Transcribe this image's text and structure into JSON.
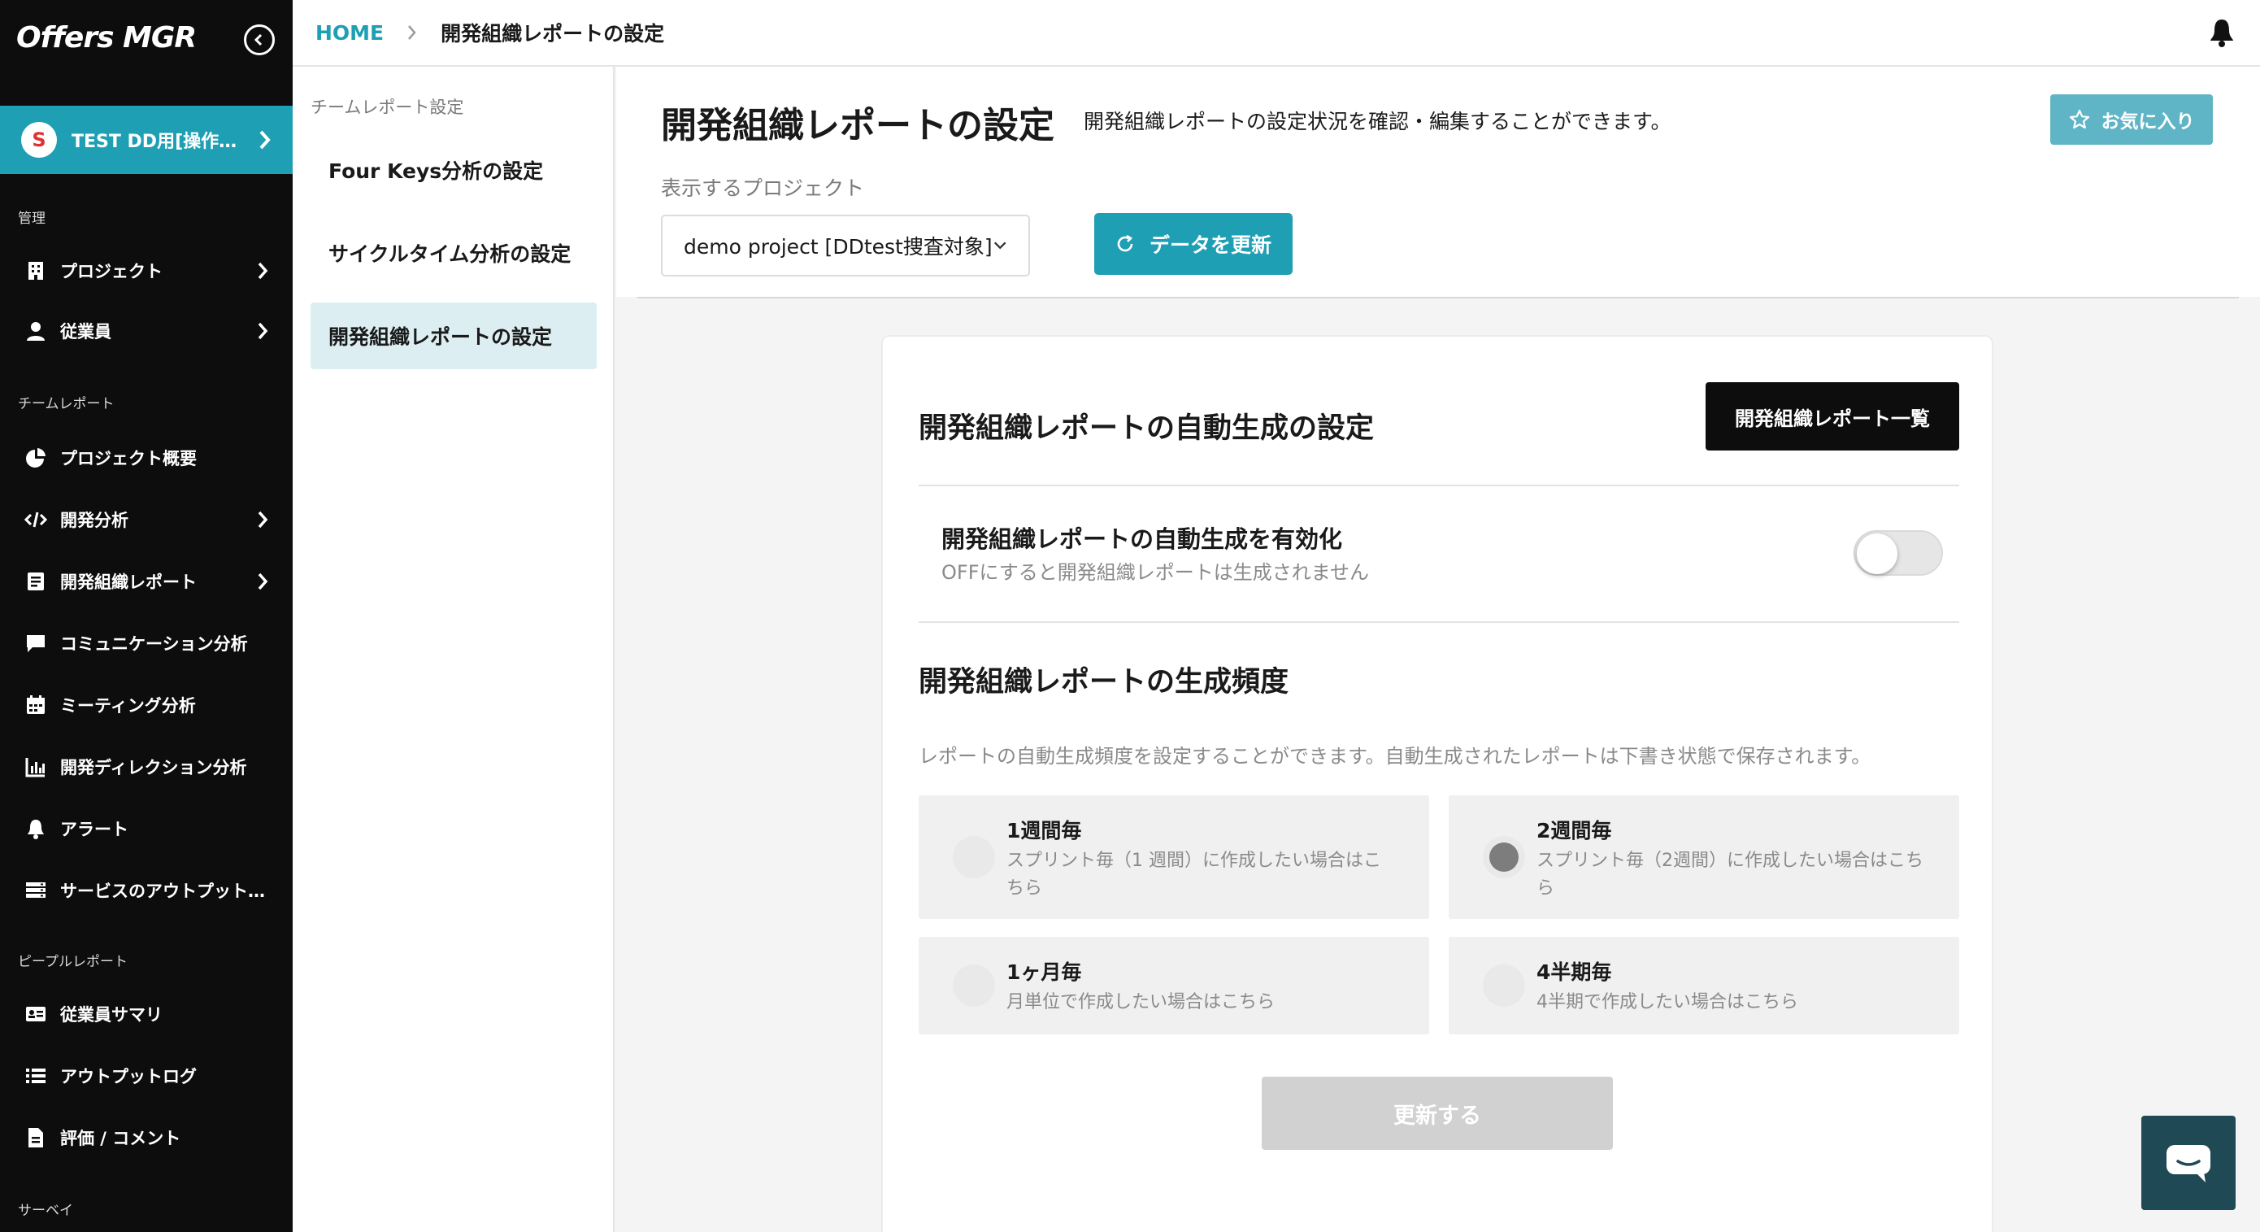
{
  "brand": {
    "logo_text": "Offers MGR"
  },
  "org": {
    "initial": "S",
    "name": "TEST DD用[操作…"
  },
  "sidebar": {
    "sections": {
      "admin": "管理",
      "team_report": "チームレポート",
      "people_report": "ピープルレポート",
      "survey": "サーベイ"
    },
    "items": [
      {
        "label": "プロジェクト",
        "icon": "building-icon"
      },
      {
        "label": "従業員",
        "icon": "person-icon"
      },
      {
        "label": "プロジェクト概要",
        "icon": "pie-chart-icon"
      },
      {
        "label": "開発分析",
        "icon": "code-icon"
      },
      {
        "label": "開発組織レポート",
        "icon": "document-icon"
      },
      {
        "label": "コミュニケーション分析",
        "icon": "chat-bubble-icon"
      },
      {
        "label": "ミーティング分析",
        "icon": "calendar-icon"
      },
      {
        "label": "開発ディレクション分析",
        "icon": "bar-chart-icon"
      },
      {
        "label": "アラート",
        "icon": "bell-icon"
      },
      {
        "label": "サービスのアウトプット…",
        "icon": "server-icon"
      },
      {
        "label": "従業員サマリ",
        "icon": "id-card-icon"
      },
      {
        "label": "アウトプットログ",
        "icon": "list-icon"
      },
      {
        "label": "評価 / コメント",
        "icon": "file-icon"
      }
    ]
  },
  "breadcrumb": {
    "home": "HOME",
    "current": "開発組織レポートの設定"
  },
  "subnav": {
    "title": "チームレポート設定",
    "items": [
      {
        "label": "Four Keys分析の設定"
      },
      {
        "label": "サイクルタイム分析の設定"
      },
      {
        "label": "開発組織レポートの設定"
      }
    ]
  },
  "page": {
    "title": "開発組織レポートの設定",
    "description": "開発組織レポートの設定状況を確認・編集することができます。",
    "favorite_label": "お気に入り",
    "project_label": "表示するプロジェクト",
    "project_value": "demo project [DDtest捜査対象]",
    "refresh_label": "データを更新"
  },
  "card": {
    "title": "開発組織レポートの自動生成の設定",
    "list_button": "開発組織レポート一覧",
    "toggle_title": "開発組織レポートの自動生成を有効化",
    "toggle_sub": "OFFにすると開発組織レポートは生成されません",
    "toggle_on": false,
    "freq_title": "開発組織レポートの生成頻度",
    "freq_help": "レポートの自動生成頻度を設定することができます。自動生成されたレポートは下書き状態で保存されます。",
    "options": [
      {
        "title": "1週間毎",
        "desc": "スプリント毎（1 週間）に作成したい場合はこちら",
        "selected": false
      },
      {
        "title": "2週間毎",
        "desc": "スプリント毎（2週間）に作成したい場合はこちら",
        "selected": true
      },
      {
        "title": "1ヶ月毎",
        "desc": "月単位で作成したい場合はこちら",
        "selected": false
      },
      {
        "title": "4半期毎",
        "desc": "4半期で作成したい場合はこちら",
        "selected": false
      }
    ],
    "submit_label": "更新する"
  },
  "colors": {
    "accent": "#1f9fb3",
    "sidebar_bg": "#0d0d0d",
    "favorite_bg": "#5fb5c6"
  }
}
